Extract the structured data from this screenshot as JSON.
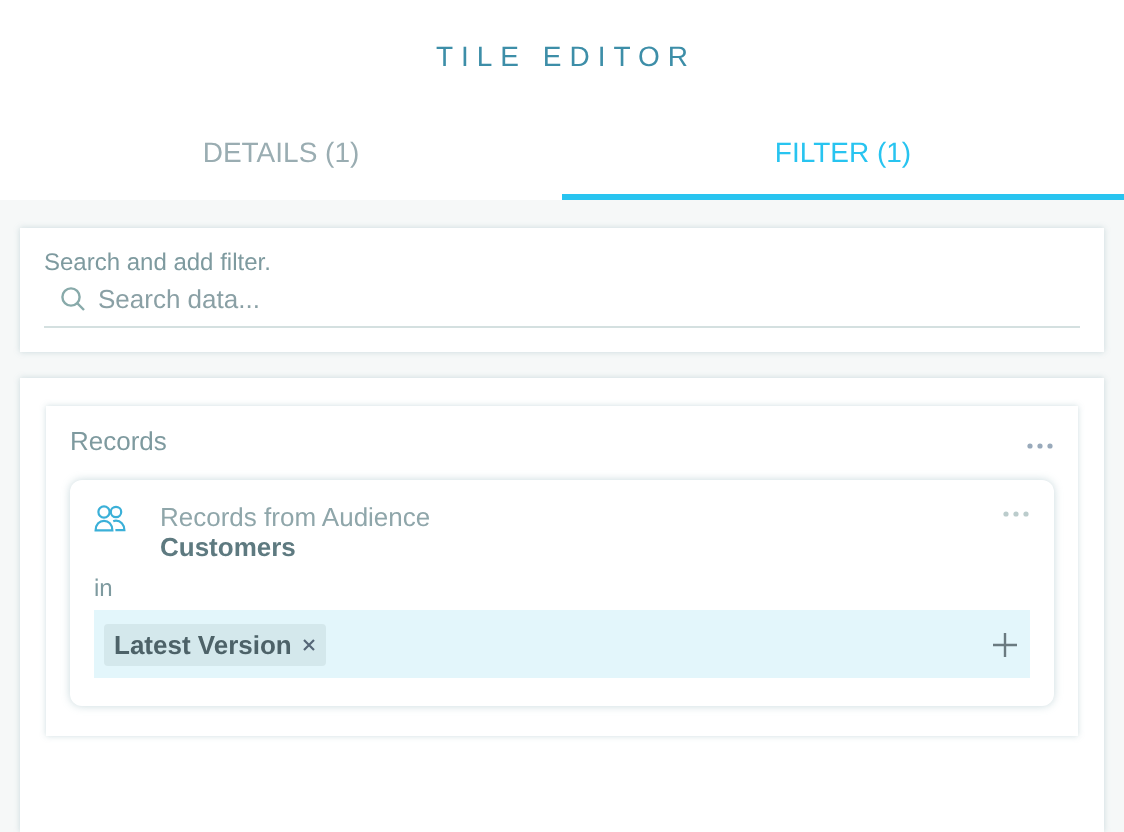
{
  "window": {
    "title": "TILE EDITOR"
  },
  "tabs": [
    {
      "label": "DETAILS (1)",
      "selected": false
    },
    {
      "label": "FILTER (1)",
      "selected": true
    }
  ],
  "search": {
    "label": "Search and add filter.",
    "placeholder": "Search data..."
  },
  "group": {
    "title": "Records",
    "filter": {
      "title": "Records from Audience",
      "audience": "Customers",
      "operator": "in",
      "tags": [
        "Latest Version"
      ]
    }
  }
}
